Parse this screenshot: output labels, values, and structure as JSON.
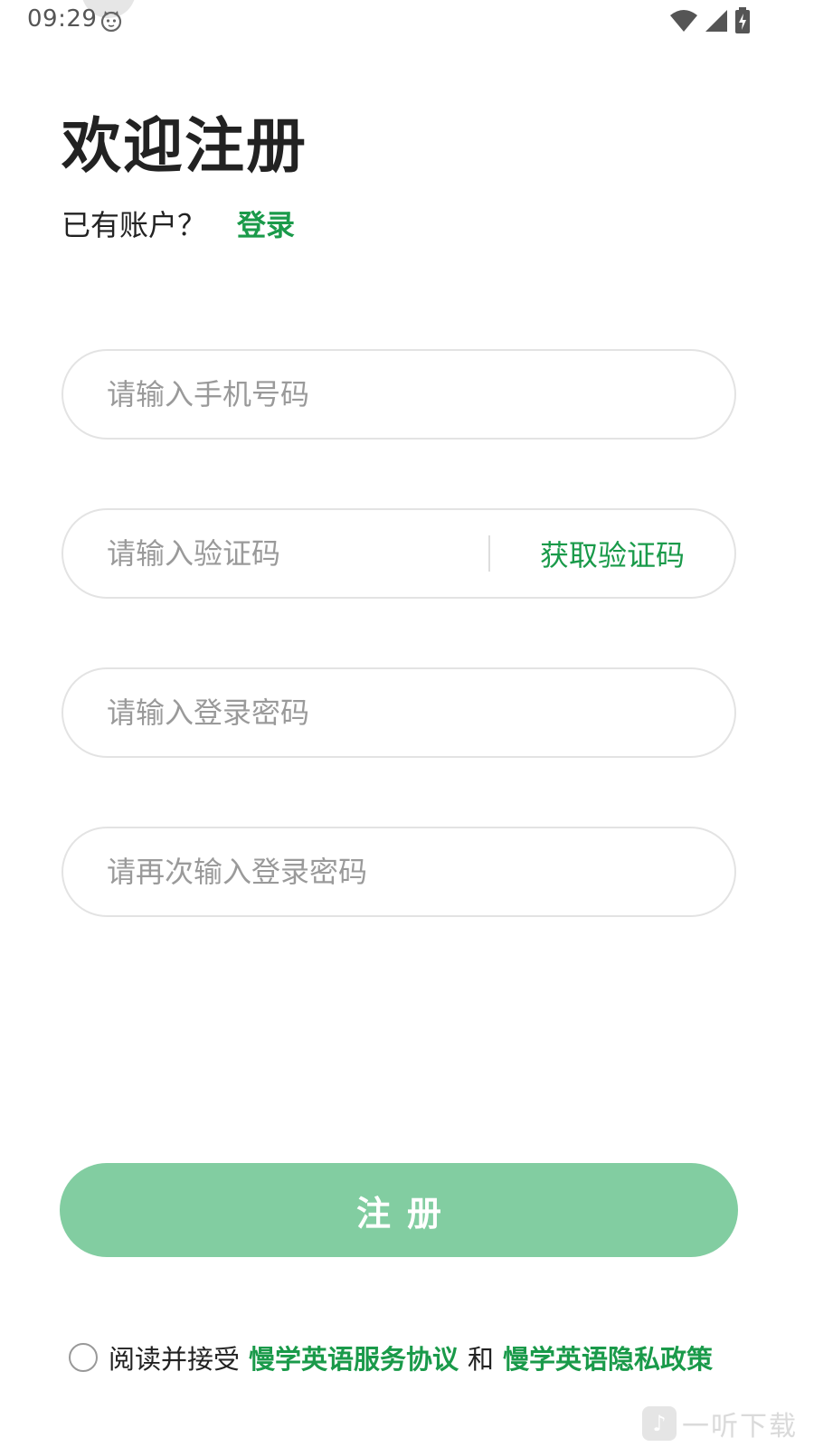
{
  "status_bar": {
    "time": "09:29",
    "icons": [
      "cat-notification-icon",
      "wifi-icon",
      "signal-icon",
      "battery-charging-icon"
    ]
  },
  "header": {
    "title": "欢迎注册",
    "account_prompt": "已有账户？",
    "login_link": "登录"
  },
  "form": {
    "phone_placeholder": "请输入手机号码",
    "code_placeholder": "请输入验证码",
    "get_code_label": "获取验证码",
    "password_placeholder": "请输入登录密码",
    "confirm_password_placeholder": "请再次输入登录密码"
  },
  "register_button": {
    "label": "注册",
    "color": "#82cda1"
  },
  "agreement": {
    "checked": false,
    "prefix": "阅读并接受",
    "service_link": "慢学英语服务协议",
    "and": "和",
    "privacy_link": "慢学英语隐私政策"
  },
  "watermark": {
    "text": "一听下载"
  },
  "colors": {
    "accent": "#1a9a4a",
    "button": "#82cda1",
    "border": "#e3e3e3",
    "placeholder": "#9a9a9a",
    "title": "#222222"
  }
}
